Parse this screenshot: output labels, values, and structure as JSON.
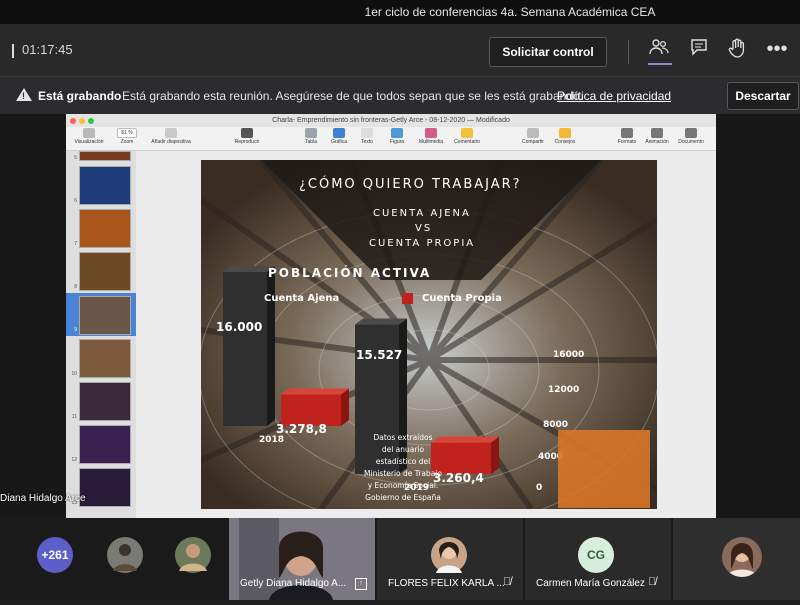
{
  "window": {
    "title": "1er ciclo de conferencias 4a. Semana Académica CEA"
  },
  "meeting": {
    "timer": "01:17:45",
    "request_control_label": "Solicitar control",
    "icons": [
      "people-icon",
      "chat-icon",
      "raise-hand-icon",
      "more-icon"
    ]
  },
  "recording": {
    "title": "Está grabando",
    "message": "Está grabando esta reunión. Asegúrese de que todos sepan que se les está grabando.",
    "privacy_link": "Política de privacidad",
    "dismiss_label": "Descartar"
  },
  "keynote": {
    "title": "Charla- Emprendimiento sin fronteras-Getly Arce - 08-12-2020 — Modificado",
    "toolbar": [
      "Visualización",
      "Zoom",
      "Añadir diapositiva",
      "Reproducir",
      "Tabla",
      "Gráfica",
      "Texto",
      "Figura",
      "Multimedia",
      "Comentario",
      "Compartir",
      "Consejos",
      "Formato",
      "Animación",
      "Documento"
    ],
    "zoom": "81 %",
    "thumb_numbers": [
      "5",
      "6",
      "7",
      "8",
      "9",
      "10",
      "11",
      "12",
      "13"
    ]
  },
  "slide": {
    "title": "¿CÓMO QUIERO TRABAJAR?",
    "subtitle1": "CUENTA AJENA",
    "vs": "VS",
    "subtitle2": "CUENTA PROPIA",
    "chart_title": "POBLACIÓN ACTIVA",
    "legend": [
      "Cuenta Ajena",
      "Cuenta Propia"
    ],
    "note": [
      "Datos extraídos",
      "del anuario",
      "estadístico del",
      "Ministerio de Trabajo",
      "y Economía Social.",
      "Gobierno de España"
    ]
  },
  "chart_data": {
    "type": "bar",
    "title": "POBLACIÓN ACTIVA",
    "categories": [
      "2018",
      "2019"
    ],
    "series": [
      {
        "name": "Cuenta Ajena",
        "values": [
          16000,
          15527
        ],
        "labels": [
          "16.000",
          "15.527"
        ]
      },
      {
        "name": "Cuenta Propia",
        "values": [
          3278.8,
          3260.4
        ],
        "labels": [
          "3.278,8",
          "3.260,4"
        ]
      }
    ],
    "axis_ticks": [
      "16000",
      "12000",
      "8000",
      "4000",
      "0"
    ],
    "ylim": [
      0,
      16000
    ],
    "colors": {
      "Cuenta Ajena": "#2f2f2f",
      "Cuenta Propia": "#c0231e"
    }
  },
  "presenter": {
    "name": "Diana Hidalgo Arce"
  },
  "participants": {
    "overflow": "+261",
    "tiles": [
      {
        "name": "Getly Diana Hidalgo A..."
      },
      {
        "name": "FLORES FELIX KARLA ..."
      },
      {
        "name": "Carmen María González",
        "initials": "CG"
      }
    ]
  }
}
